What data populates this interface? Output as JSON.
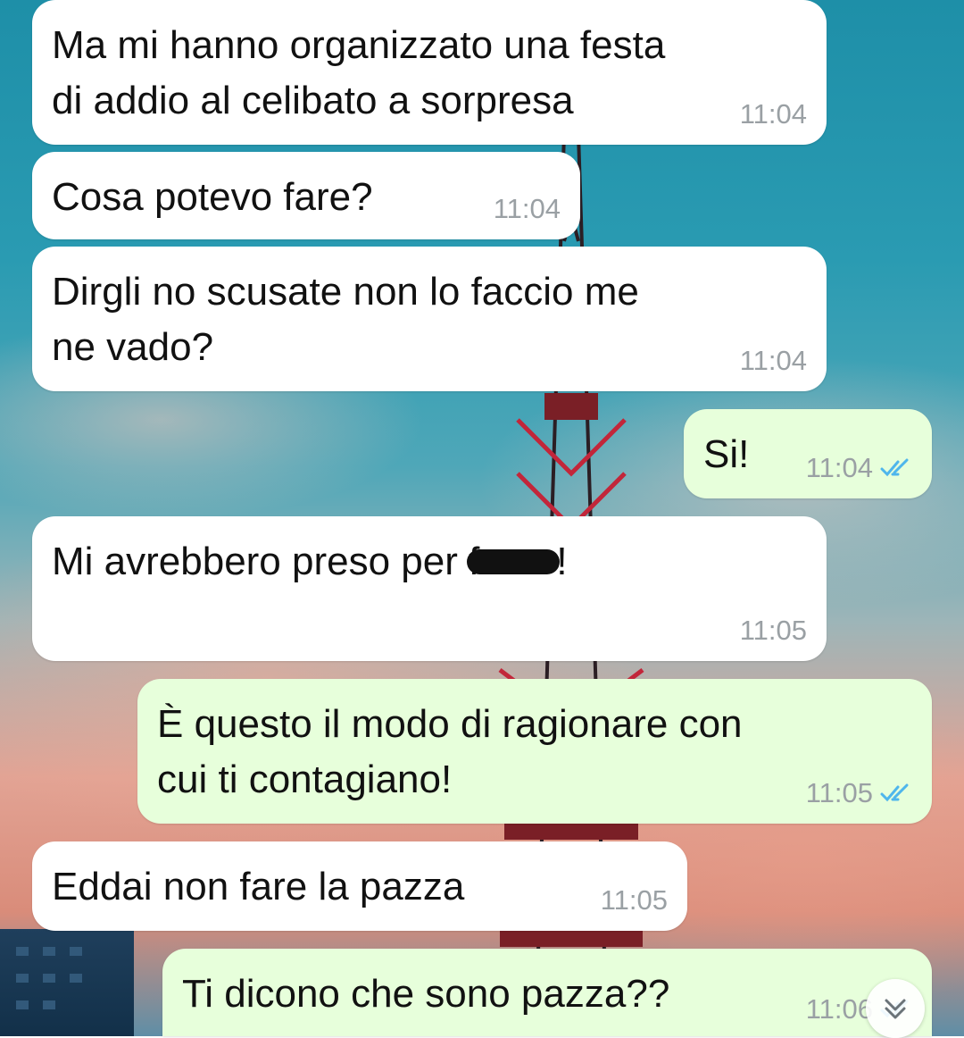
{
  "messages": [
    {
      "dir": "in",
      "text": "Ma mi hanno organizzato una festa\ndi addio al celibato a sorpresa",
      "time": "11:04"
    },
    {
      "dir": "in",
      "text": "Cosa potevo fare?",
      "time": "11:04"
    },
    {
      "dir": "in",
      "text": "Dirgli no scusate non lo faccio me\nne vado?",
      "time": "11:04"
    },
    {
      "dir": "out",
      "text": "Si!",
      "time": "11:04",
      "status": "read"
    },
    {
      "dir": "in",
      "text_before": "Mi avrebbero preso per f",
      "text_after": "!",
      "time": "11:05"
    },
    {
      "dir": "out",
      "text": "È questo il modo di ragionare con\ncui ti contagiano!",
      "time": "11:05",
      "status": "read"
    },
    {
      "dir": "in",
      "text": "Eddai non fare la pazza",
      "time": "11:05"
    },
    {
      "dir": "out",
      "text": "Ti dicono che sono pazza??",
      "time": "11:06",
      "status": "read"
    }
  ],
  "icons": {
    "read_receipt": "double-check-icon",
    "scroll_down": "chevron-double-down-icon"
  },
  "colors": {
    "incoming_bubble": "#ffffff",
    "outgoing_bubble": "#e7ffdb",
    "read_tick": "#4fb6ec",
    "timestamp": "#9aa0a4"
  }
}
